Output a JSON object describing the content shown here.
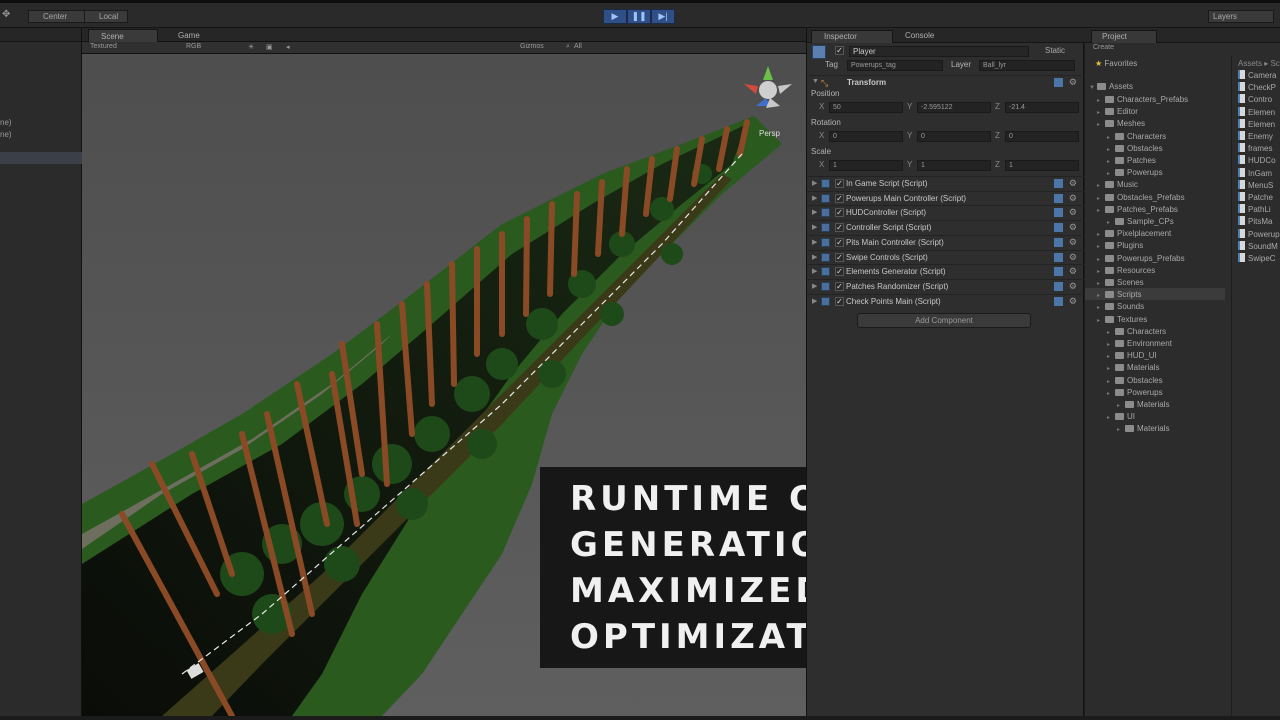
{
  "toolbar": {
    "pivot_label": "Center",
    "space_label": "Local",
    "play_icon": "play-icon",
    "pause_icon": "pause-icon",
    "step_icon": "step-icon",
    "layers_label": "Layers"
  },
  "left_panel": {
    "items": [
      "ne)",
      "ne)"
    ]
  },
  "scene": {
    "tabs": [
      "Scene",
      "Game"
    ],
    "draw_mode": "Textured",
    "render_mode": "RGB",
    "gizmos_label": "Gizmos",
    "search_placeholder": "All",
    "persp_label": "Persp"
  },
  "caption": {
    "lines": [
      "RUNTIME OBJECT",
      "GENERATION FOR",
      "MAXIMIZED",
      "OPTIMIZATION"
    ]
  },
  "inspector": {
    "tabs": [
      "Inspector",
      "Console"
    ],
    "object_name": "Player",
    "static_label": "Static",
    "tag_label": "Tag",
    "tag_value": "Powerups_tag",
    "layer_label": "Layer",
    "layer_value": "Ball_lyr",
    "transform_title": "Transform",
    "position_label": "Position",
    "rotation_label": "Rotation",
    "scale_label": "Scale",
    "position": {
      "x": "50",
      "y": "-2.595122",
      "z": "-21.4"
    },
    "rotation": {
      "x": "0",
      "y": "0",
      "z": "0"
    },
    "scale": {
      "x": "1",
      "y": "1",
      "z": "1"
    },
    "components": [
      "In Game Script (Script)",
      "Powerups Main Controller (Script)",
      "HUDController (Script)",
      "Controller Script (Script)",
      "Pits Main Controller (Script)",
      "Swipe Controls (Script)",
      "Elements Generator (Script)",
      "Patches Randomizer (Script)",
      "Check Points Main (Script)"
    ],
    "add_component_label": "Add Component"
  },
  "project": {
    "tab": "Project",
    "create_label": "Create",
    "favorites_label": "Favorites",
    "assets_label": "Assets",
    "tree": [
      {
        "label": "Characters_Prefabs",
        "depth": 1
      },
      {
        "label": "Editor",
        "depth": 1
      },
      {
        "label": "Meshes",
        "depth": 1
      },
      {
        "label": "Characters",
        "depth": 2
      },
      {
        "label": "Obstacles",
        "depth": 2
      },
      {
        "label": "Patches",
        "depth": 2
      },
      {
        "label": "Powerups",
        "depth": 2
      },
      {
        "label": "Music",
        "depth": 1
      },
      {
        "label": "Obstacles_Prefabs",
        "depth": 1
      },
      {
        "label": "Patches_Prefabs",
        "depth": 1
      },
      {
        "label": "Sample_CPs",
        "depth": 2
      },
      {
        "label": "Pixelplacement",
        "depth": 1
      },
      {
        "label": "Plugins",
        "depth": 1
      },
      {
        "label": "Powerups_Prefabs",
        "depth": 1
      },
      {
        "label": "Resources",
        "depth": 1
      },
      {
        "label": "Scenes",
        "depth": 1
      },
      {
        "label": "Scripts",
        "depth": 1
      },
      {
        "label": "Sounds",
        "depth": 1
      },
      {
        "label": "Textures",
        "depth": 1
      },
      {
        "label": "Characters",
        "depth": 2
      },
      {
        "label": "Environment",
        "depth": 2
      },
      {
        "label": "HUD_UI",
        "depth": 2
      },
      {
        "label": "Materials",
        "depth": 2
      },
      {
        "label": "Obstacles",
        "depth": 2
      },
      {
        "label": "Powerups",
        "depth": 2
      },
      {
        "label": "Materials",
        "depth": 3
      },
      {
        "label": "UI",
        "depth": 2
      },
      {
        "label": "Materials",
        "depth": 3
      }
    ],
    "files_header": "Assets ▸ Sc",
    "files": [
      "Camera",
      "CheckP",
      "Contro",
      "Elemen",
      "Elemen",
      "Enemy",
      "frames",
      "HUDCo",
      "InGam",
      "MenuS",
      "Patche",
      "PathLi",
      "PitsMa",
      "Powerup",
      "SoundM",
      "SwipeC"
    ]
  },
  "colors": {
    "accent_play": "#2f4f86",
    "panel_bg": "#2e2e2e",
    "viewport_bg": "#5a5a5a",
    "grass": "#2f6a24",
    "trunk": "#a0522d"
  }
}
